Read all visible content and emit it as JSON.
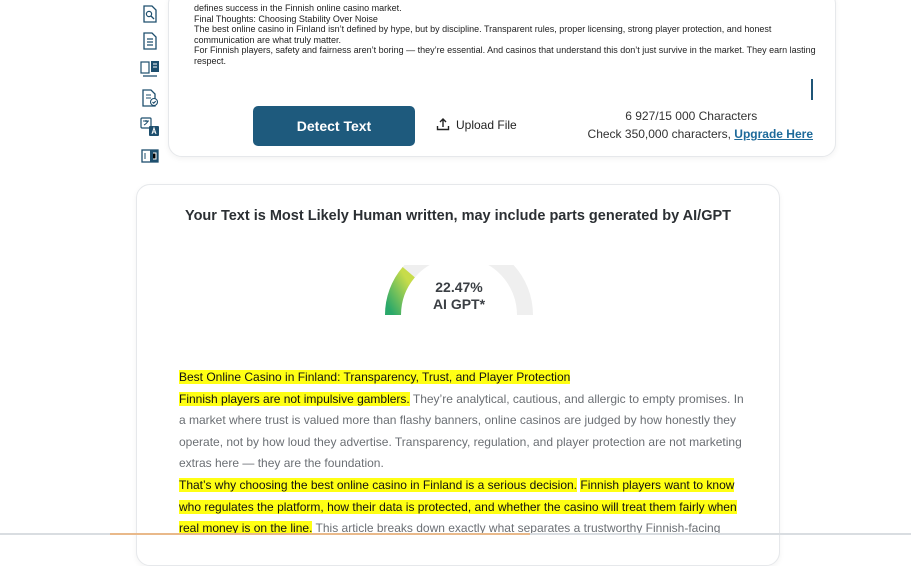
{
  "rail": {
    "icons": [
      "doc-search-icon",
      "document-icon",
      "doc-compare-icon",
      "doc-check-icon",
      "translate-icon",
      "split-view-icon"
    ]
  },
  "input": {
    "lines": [
      "defines success in the Finnish online casino market.",
      "Final Thoughts: Choosing Stability Over Noise",
      "The best online casino in Finland isn’t defined by hype, but by discipline. Transparent rules, proper licensing, strong player protection, and honest communication are what truly matter.",
      "For Finnish players, safety and fairness aren’t boring — they’re essential. And casinos that understand this don’t just survive in the market. They earn lasting respect."
    ],
    "detect_label": "Detect Text",
    "upload_label": "Upload File",
    "char_count": "6 927/15 000 Characters",
    "check_text": "Check 350,000 characters, ",
    "upgrade_label": "Upgrade Here"
  },
  "result": {
    "title": "Your Text is Most Likely Human written, may include parts generated by AI/GPT",
    "percent": "22.47%",
    "percent_value": 22.47,
    "gauge_label": "AI GPT*",
    "colors": {
      "gauge_start": "#2aa86a",
      "gauge_end": "#c7dc4a",
      "gauge_track": "#efefef",
      "highlight": "#ffff14"
    },
    "paragraphs": [
      [
        {
          "text": "Best Online Casino in Finland: Transparency, Trust, and Player Protection",
          "hl": true
        }
      ],
      [
        {
          "text": "Finnish players are not impulsive gamblers.",
          "hl": true
        },
        {
          "text": " They’re analytical, cautious, and allergic to empty promises. In a market where trust is valued more than flashy banners, online casinos are judged by how honestly they operate, not by how loud they advertise. Transparency, regulation, and player protection are not marketing extras here — they are the foundation.",
          "hl": false
        }
      ],
      [
        {
          "text": "That’s why choosing the best online casino in Finland is a serious decision.",
          "hl": true
        },
        {
          "text": " ",
          "hl": false
        },
        {
          "text": "Finnish players want to know who regulates the platform, how their data is protected, and whether the casino will treat them fairly when real money is on the line.",
          "hl": true
        },
        {
          "text": " This article breaks down exactly what separates a trustworthy Finnish-facing",
          "hl": false
        }
      ]
    ]
  }
}
